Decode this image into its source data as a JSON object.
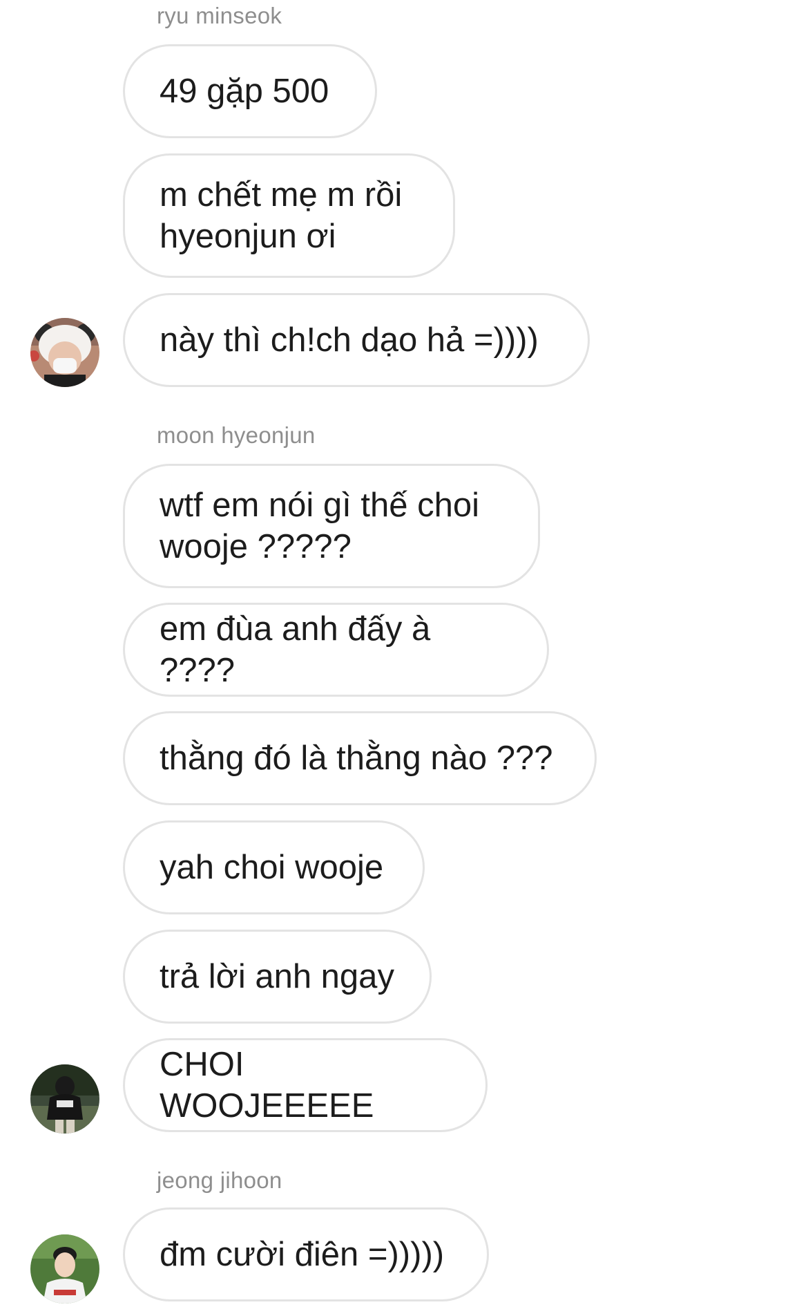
{
  "chat": {
    "groups": [
      {
        "sender": "ryu minseok",
        "messages": [
          "49 gặp 500",
          "m chết mẹ m rồi\nhyeonjun ơi",
          "này thì ch!ch dạo hả =))))"
        ],
        "avatar_icon": "user-avatar-panda-hat"
      },
      {
        "sender": "moon hyeonjun",
        "messages": [
          "wtf em nói gì thế choi\nwooje ?????",
          "em đùa anh đấy à ????",
          "thằng đó là thằng nào ???",
          "yah choi wooje",
          "trả lời anh ngay",
          "CHOI WOOJEEEEE"
        ],
        "avatar_icon": "user-avatar-dark-hoodie"
      },
      {
        "sender": "jeong jihoon",
        "messages": [
          "đm cười điên =)))))"
        ],
        "avatar_icon": "user-avatar-green-background"
      }
    ]
  }
}
